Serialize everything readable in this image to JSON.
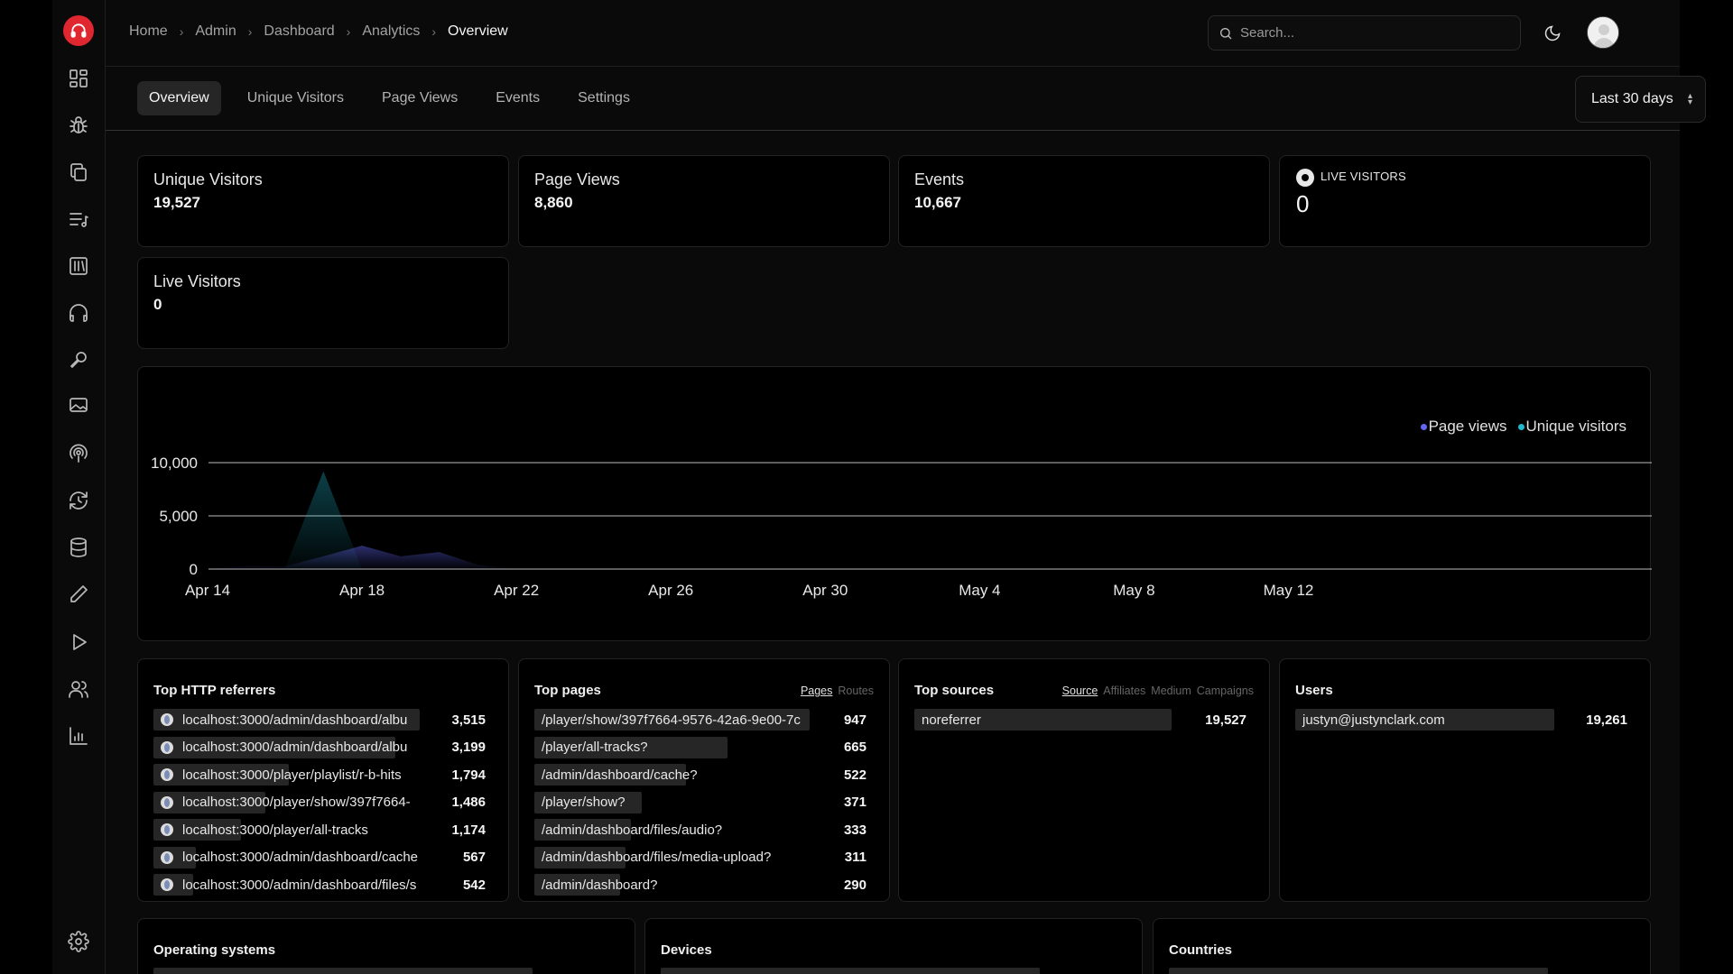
{
  "breadcrumb": [
    {
      "label": "Home"
    },
    {
      "label": "Admin"
    },
    {
      "label": "Dashboard"
    },
    {
      "label": "Analytics"
    },
    {
      "label": "Overview"
    }
  ],
  "search": {
    "placeholder": "Search..."
  },
  "tabs": [
    {
      "label": "Overview",
      "active": true
    },
    {
      "label": "Unique Visitors"
    },
    {
      "label": "Page Views"
    },
    {
      "label": "Events"
    },
    {
      "label": "Settings"
    }
  ],
  "date_range": {
    "value": "Last 30 days"
  },
  "stats": {
    "unique_visitors": {
      "label": "Unique Visitors",
      "value": "19,527"
    },
    "page_views": {
      "label": "Page Views",
      "value": "8,860"
    },
    "events": {
      "label": "Events",
      "value": "10,667"
    },
    "live_badge": {
      "label": "LIVE VISITORS",
      "value": "0"
    },
    "live_visitors": {
      "label": "Live Visitors",
      "value": "0"
    }
  },
  "chart_data": {
    "type": "area",
    "x": [
      "Apr 14",
      "Apr 15",
      "Apr 16",
      "Apr 17",
      "Apr 18",
      "Apr 19",
      "Apr 20",
      "Apr 21",
      "Apr 22",
      "Apr 23",
      "Apr 24",
      "Apr 25",
      "Apr 26",
      "Apr 27",
      "Apr 28",
      "Apr 29",
      "Apr 30",
      "May 1",
      "May 2",
      "May 3",
      "May 4",
      "May 5",
      "May 6",
      "May 7",
      "May 8",
      "May 9",
      "May 10",
      "May 11",
      "May 12",
      "May 13",
      "May 14",
      "May 15"
    ],
    "x_ticks": [
      "Apr 14",
      "Apr 18",
      "Apr 22",
      "Apr 26",
      "Apr 30",
      "May 4",
      "May 8",
      "May 12"
    ],
    "y_ticks": [
      "10,000",
      "5,000",
      "0"
    ],
    "ylim": [
      0,
      10000
    ],
    "legend_position": "top-right",
    "series": [
      {
        "name": "Page views",
        "color": "#6366f1",
        "values": [
          0,
          300,
          250,
          1200,
          2200,
          1200,
          1600,
          400,
          0,
          0,
          0,
          0,
          0,
          0,
          0,
          0,
          0,
          0,
          0,
          0,
          0,
          0,
          0,
          0,
          0,
          0,
          0,
          0,
          0,
          0,
          0,
          0
        ]
      },
      {
        "name": "Unique visitors",
        "color": "#22b8cf",
        "values": [
          0,
          0,
          0,
          9200,
          0,
          0,
          0,
          0,
          0,
          0,
          0,
          0,
          0,
          0,
          0,
          0,
          0,
          0,
          0,
          0,
          0,
          0,
          0,
          0,
          0,
          0,
          0,
          0,
          0,
          0,
          0,
          0
        ]
      }
    ]
  },
  "referrers": {
    "title": "Top HTTP referrers",
    "rows": [
      {
        "label": "localhost:3000/admin/dashboard/albu",
        "count": "3,515",
        "share": 1.0
      },
      {
        "label": "localhost:3000/admin/dashboard/albu",
        "count": "3,199",
        "share": 0.91
      },
      {
        "label": "localhost:3000/player/playlist/r-b-hits",
        "count": "1,794",
        "share": 0.51
      },
      {
        "label": "localhost:3000/player/show/397f7664-",
        "count": "1,486",
        "share": 0.42
      },
      {
        "label": "localhost:3000/player/all-tracks",
        "count": "1,174",
        "share": 0.33
      },
      {
        "label": "localhost:3000/admin/dashboard/cache",
        "count": "567",
        "share": 0.16
      },
      {
        "label": "localhost:3000/admin/dashboard/files/s",
        "count": "542",
        "share": 0.15
      }
    ]
  },
  "pages": {
    "title": "Top pages",
    "tabs": [
      {
        "label": "Pages",
        "active": true
      },
      {
        "label": "Routes"
      }
    ],
    "rows": [
      {
        "label": "/player/show/397f7664-9576-42a6-9e00-7c",
        "count": "947",
        "share": 1.0
      },
      {
        "label": "/player/all-tracks?",
        "count": "665",
        "share": 0.7
      },
      {
        "label": "/admin/dashboard/cache?",
        "count": "522",
        "share": 0.55
      },
      {
        "label": "/player/show?",
        "count": "371",
        "share": 0.39
      },
      {
        "label": "/admin/dashboard/files/audio?",
        "count": "333",
        "share": 0.35
      },
      {
        "label": "/admin/dashboard/files/media-upload?",
        "count": "311",
        "share": 0.33
      },
      {
        "label": "/admin/dashboard?",
        "count": "290",
        "share": 0.31
      }
    ]
  },
  "sources": {
    "title": "Top sources",
    "tabs": [
      {
        "label": "Source",
        "active": true
      },
      {
        "label": "Affiliates"
      },
      {
        "label": "Medium"
      },
      {
        "label": "Campaigns"
      }
    ],
    "rows": [
      {
        "label": "noreferrer",
        "count": "19,527",
        "share": 1.0
      }
    ]
  },
  "users": {
    "title": "Users",
    "rows": [
      {
        "label": "justyn@justynclark.com",
        "count": "19,261",
        "share": 1.0
      }
    ]
  },
  "bottom": {
    "os": {
      "title": "Operating systems"
    },
    "devices": {
      "title": "Devices"
    },
    "countries": {
      "title": "Countries"
    }
  },
  "icons": [
    "headphones-logo-icon",
    "dashboard-grid-icon",
    "bug-icon",
    "copy-icon",
    "playlist-icon",
    "library-icon",
    "headphones-icon",
    "microphone-icon",
    "image-icon",
    "podcast-icon",
    "refresh-icon",
    "database-icon",
    "pencil-icon",
    "play-icon",
    "users-icon",
    "bar-chart-icon",
    "settings-gear-icon",
    "search-icon",
    "moon-icon",
    "chevron-right-icon",
    "chevron-up-down-icon",
    "globe-icon"
  ],
  "colors": {
    "accent": "#e0262f",
    "page_views": "#6366f1",
    "unique_visitors": "#22b8cf",
    "surface": "#000000",
    "border": "#222222"
  }
}
